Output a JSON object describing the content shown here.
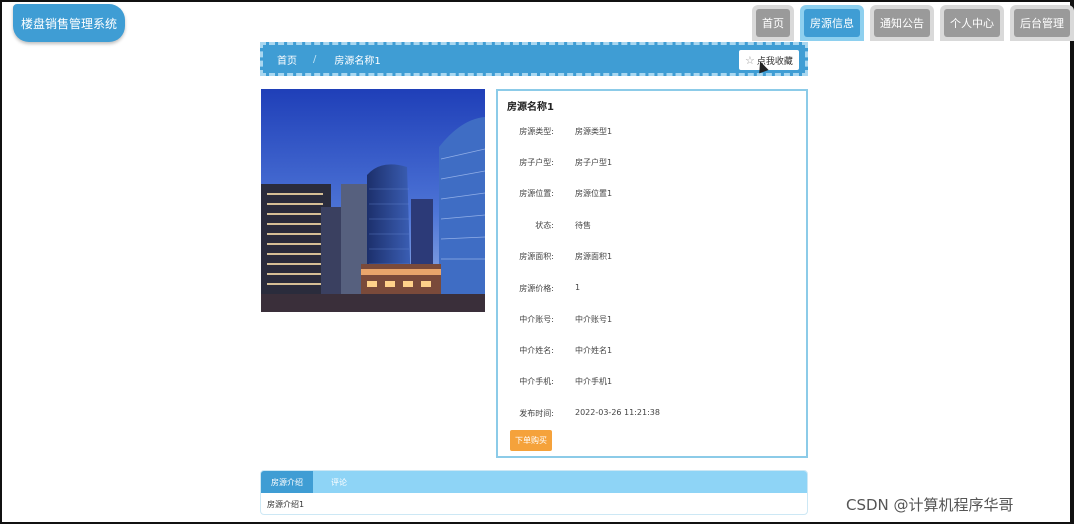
{
  "app": {
    "title": "楼盘销售管理系统"
  },
  "nav": {
    "items": [
      {
        "label": "首页",
        "active": false
      },
      {
        "label": "房源信息",
        "active": true
      },
      {
        "label": "通知公告",
        "active": false
      },
      {
        "label": "个人中心",
        "active": false
      },
      {
        "label": "后台管理",
        "active": false
      }
    ]
  },
  "breadcrumb": {
    "home": "首页",
    "separator": "/",
    "current": "房源名称1",
    "favorite_label": "点我收藏",
    "favorite_icon": "star-icon"
  },
  "detail": {
    "title": "房源名称1",
    "fields": [
      {
        "label": "房源类型:",
        "value": "房源类型1"
      },
      {
        "label": "房子户型:",
        "value": "房子户型1"
      },
      {
        "label": "房源位置:",
        "value": "房源位置1"
      },
      {
        "label": "状态:",
        "value": "待售"
      },
      {
        "label": "房源面积:",
        "value": "房源面积1"
      },
      {
        "label": "房源价格:",
        "value": "1"
      },
      {
        "label": "中介账号:",
        "value": "中介账号1"
      },
      {
        "label": "中介姓名:",
        "value": "中介姓名1"
      },
      {
        "label": "中介手机:",
        "value": "中介手机1"
      },
      {
        "label": "发布时间:",
        "value": "2022-03-26 11:21:38"
      }
    ],
    "order_button": "下单购买"
  },
  "tabs": {
    "items": [
      {
        "label": "房源介绍",
        "active": true
      },
      {
        "label": "评论",
        "active": false
      }
    ],
    "content": "房源介绍1"
  },
  "watermark": "CSDN @计算机程序华哥",
  "colors": {
    "primary": "#3f9dd4",
    "light": "#8ed4f6",
    "order": "#f5a23b"
  }
}
